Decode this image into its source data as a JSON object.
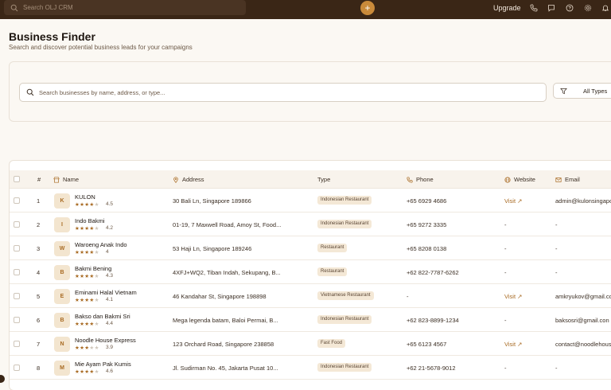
{
  "topbar": {
    "search_placeholder": "Search OLJ CRM",
    "add_label": "+",
    "upgrade_label": "Upgrade",
    "icons": [
      "phone-icon",
      "message-icon",
      "help-icon",
      "settings-icon",
      "bell-icon"
    ]
  },
  "header": {
    "title": "Business Finder",
    "subtitle": "Search and discover potential business leads for your campaigns"
  },
  "search": {
    "placeholder": "Search businesses by name, address, or type...",
    "type_filter": "All Types"
  },
  "table": {
    "columns": {
      "index": "#",
      "name": "Name",
      "address": "Address",
      "type": "Type",
      "phone": "Phone",
      "website": "Website",
      "email": "Email"
    },
    "rows": [
      {
        "index": "1",
        "initial": "K",
        "name": "KULON",
        "stars": 4,
        "rating": "4.5",
        "address": "30 Bali Ln, Singapore 189866",
        "type": "Indonesian Restaurant",
        "phone": "+65 6929 4686",
        "website": "Visit ↗",
        "email": "admin@kulonsingapo"
      },
      {
        "index": "2",
        "initial": "I",
        "name": "Indo Bakmi",
        "stars": 4,
        "rating": "4.2",
        "address": "01-19, 7 Maxwell Road, Amoy St, Food...",
        "type": "Indonesian Restaurant",
        "phone": "+65 9272 3335",
        "website": "-",
        "email": "-"
      },
      {
        "index": "3",
        "initial": "W",
        "name": "Waroeng Anak Indo",
        "stars": 4,
        "rating": "4",
        "address": "53 Haji Ln, Singapore 189246",
        "type": "Restaurant",
        "phone": "+65 8208 0138",
        "website": "-",
        "email": "-"
      },
      {
        "index": "4",
        "initial": "B",
        "name": "Bakmi Bening",
        "stars": 4,
        "rating": "4.3",
        "address": "4XFJ+WQ2, Tiban Indah, Sekupang, B...",
        "type": "Restaurant",
        "phone": "+62 822-7787-6262",
        "website": "-",
        "email": "-"
      },
      {
        "index": "5",
        "initial": "E",
        "name": "Eminami Halal Vietnam",
        "stars": 4,
        "rating": "4.1",
        "address": "46 Kandahar St, Singapore 198898",
        "type": "Vietnamese Restaurant",
        "phone": "-",
        "website": "Visit ↗",
        "email": "amkryukov@gmail.com"
      },
      {
        "index": "6",
        "initial": "B",
        "name": "Bakso dan Bakmi Sri",
        "stars": 4,
        "rating": "4.4",
        "address": "Mega legenda batam, Baloi Permai, B...",
        "type": "Indonesian Restaurant",
        "phone": "+62 823-8899-1234",
        "website": "-",
        "email": "baksosri@gmail.con"
      },
      {
        "index": "7",
        "initial": "N",
        "name": "Noodle House Express",
        "stars": 3,
        "rating": "3.9",
        "address": "123 Orchard Road, Singapore 238858",
        "type": "Fast Food",
        "phone": "+65 6123 4567",
        "website": "Visit ↗",
        "email": "contact@noodlehous"
      },
      {
        "index": "8",
        "initial": "M",
        "name": "Mie Ayam Pak Kumis",
        "stars": 4,
        "rating": "4.6",
        "address": "Jl. Sudirman No. 45, Jakarta Pusat 10...",
        "type": "Indonesian Restaurant",
        "phone": "+62 21-5678-9012",
        "website": "-",
        "email": "-"
      }
    ]
  },
  "colors": {
    "topbar": "#3a2616",
    "accent": "#c98a3a",
    "link": "#a86a22",
    "background": "#fbf8f3"
  }
}
